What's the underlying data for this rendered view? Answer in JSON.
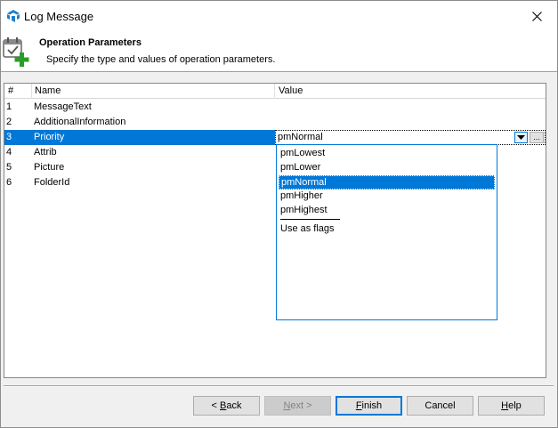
{
  "window": {
    "title": "Log Message"
  },
  "header": {
    "title": "Operation Parameters",
    "subtitle": "Specify the type and values of operation parameters."
  },
  "grid": {
    "columns": [
      "#",
      "Name",
      "Value"
    ],
    "rows": [
      {
        "num": "1",
        "name": "MessageText",
        "value": ""
      },
      {
        "num": "2",
        "name": "AdditionalInformation",
        "value": ""
      },
      {
        "num": "3",
        "name": "Priority",
        "value": "pmNormal"
      },
      {
        "num": "4",
        "name": "Attrib",
        "value": ""
      },
      {
        "num": "5",
        "name": "Picture",
        "value": ""
      },
      {
        "num": "6",
        "name": "FolderId",
        "value": ""
      }
    ],
    "selected_row": 3,
    "editor_ellipsis": "..."
  },
  "dropdown": {
    "options": [
      "pmLowest",
      "pmLower",
      "pmNormal",
      "pmHigher",
      "pmHighest"
    ],
    "selected": "pmNormal",
    "extra_option": "Use as flags"
  },
  "buttons": {
    "back": {
      "pre": "< ",
      "accel": "B",
      "post": "ack"
    },
    "next": {
      "pre": "",
      "accel": "N",
      "post": "ext >"
    },
    "finish": {
      "pre": "",
      "accel": "F",
      "post": "inish"
    },
    "cancel": "Cancel",
    "help": {
      "pre": "",
      "accel": "H",
      "post": "elp"
    }
  },
  "colors": {
    "selection": "#0078d7",
    "accent_green": "#2a9d2a"
  }
}
